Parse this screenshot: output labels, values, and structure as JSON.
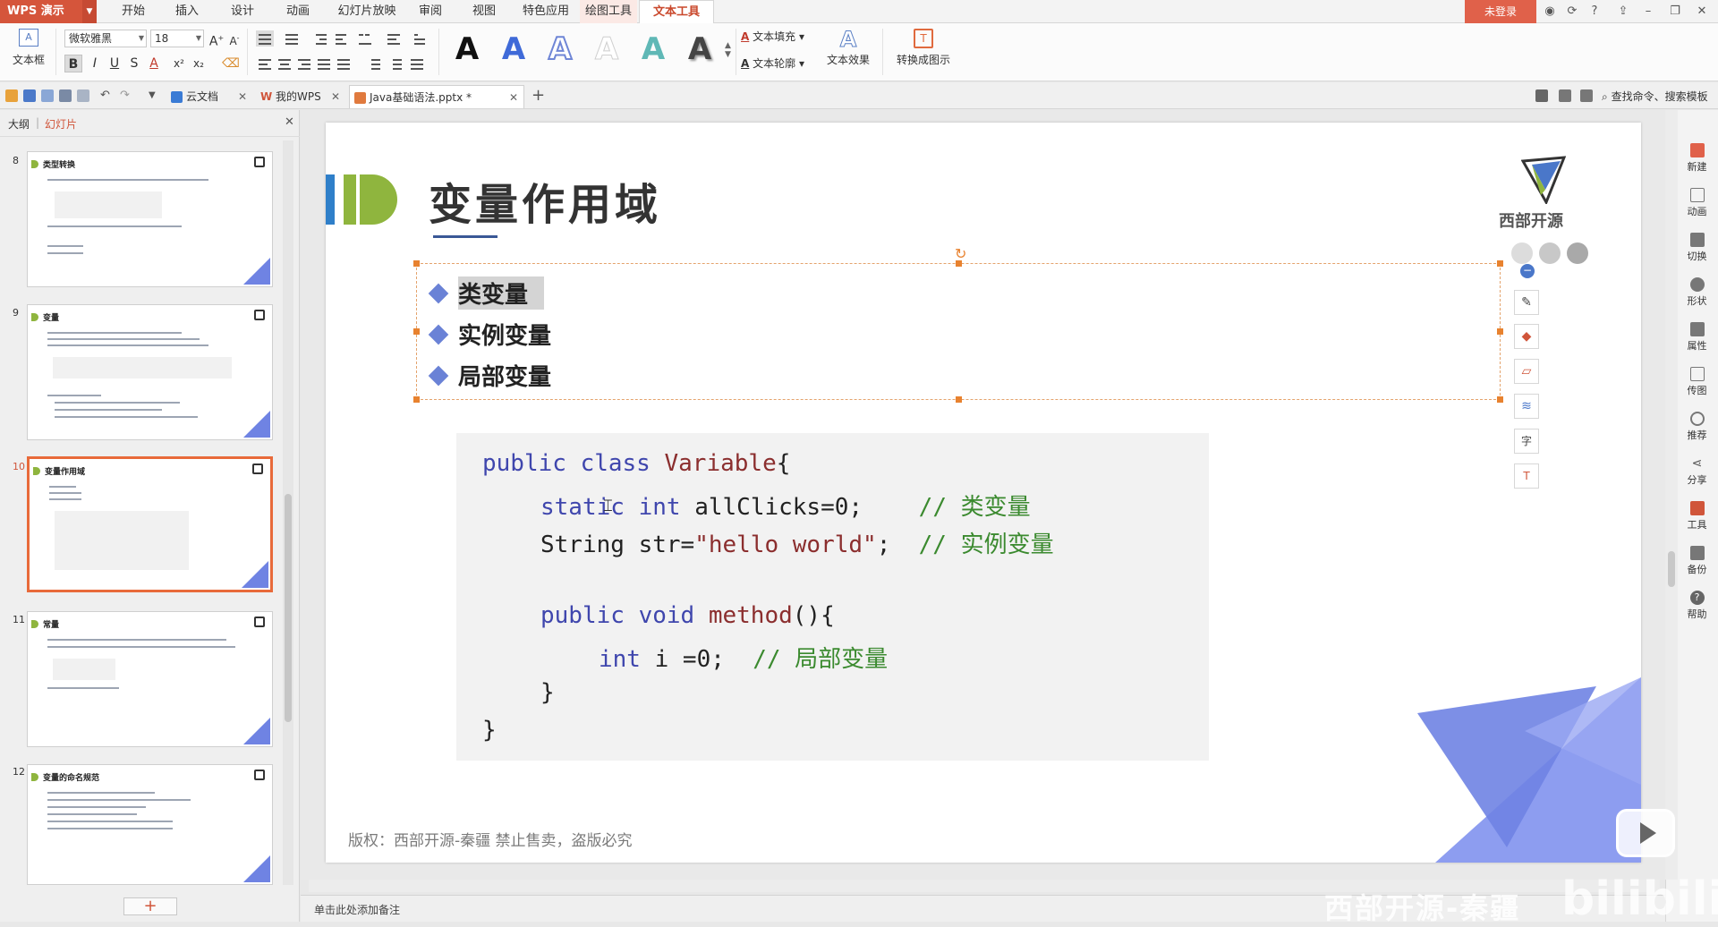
{
  "app": {
    "name": "WPS 演示",
    "login_label": "未登录",
    "menu": [
      "开始",
      "插入",
      "设计",
      "动画",
      "幻灯片放映",
      "审阅",
      "视图",
      "特色应用",
      "绘图工具",
      "文本工具"
    ],
    "active_menu": "文本工具"
  },
  "ribbon": {
    "textbox_label": "文本框",
    "font_name": "微软雅黑",
    "font_size": "18",
    "text_fill_label": "文本填充",
    "text_outline_label": "文本轮廓",
    "text_effect_label": "文本效果",
    "convert_label": "转换成图示",
    "wordart_letter": "A",
    "format_buttons": [
      "B",
      "I",
      "U",
      "S"
    ]
  },
  "tabs": {
    "items": [
      {
        "label": "云文档"
      },
      {
        "label": "我的WPS"
      },
      {
        "label": "Java基础语法.pptx *"
      }
    ],
    "search_label": "查找命令、搜索模板"
  },
  "left_panel": {
    "tab_outline": "大纲",
    "tab_slides": "幻灯片",
    "thumbnails": [
      {
        "num": "8",
        "title": "类型转换"
      },
      {
        "num": "9",
        "title": "变量"
      },
      {
        "num": "10",
        "title": "变量作用域"
      },
      {
        "num": "11",
        "title": "常量"
      },
      {
        "num": "12",
        "title": "变量的命名规范"
      }
    ],
    "add_label": "+"
  },
  "slide": {
    "title": "变量作用域",
    "bullets": [
      "类变量",
      "实例变量",
      "局部变量"
    ],
    "code": {
      "line1_kw": "public class",
      "line1_cls": "Variable",
      "line1_end": "{",
      "line2_kw": "static int",
      "line2_rest": "allClicks=0;",
      "line2_comment": "// 类变量",
      "line3_type": "String str=",
      "line3_str": "\"hello world\"",
      "line3_end": ";",
      "line3_comment": "// 实例变量",
      "line4_kw": "public void",
      "line4_name": "method",
      "line4_end": "(){",
      "line5_kw": "int",
      "line5_rest": "i =0;",
      "line5_comment": "// 局部变量",
      "line6": "}",
      "line7": "}"
    },
    "copyright": "版权：西部开源-秦疆    禁止售卖，盗版必究",
    "logo_text": "西部开源"
  },
  "notes_placeholder": "单击此处添加备注",
  "right_sidebar": [
    "新建",
    "动画",
    "切换",
    "形状",
    "属性",
    "传图",
    "推荐",
    "分享",
    "工具",
    "备份",
    "帮助"
  ],
  "watermark": "西部开源-秦疆",
  "watermark_brand": "bilibili",
  "colors": {
    "accent": "#d5553b",
    "bullet": "#6a82d6",
    "keyword": "#3f46ad",
    "string": "#8b2e2e",
    "comment": "#3b8a2f"
  }
}
